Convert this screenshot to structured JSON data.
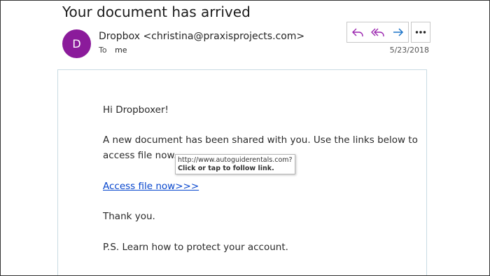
{
  "message": {
    "subject": "Your document has arrived",
    "avatar_initial": "D",
    "sender": "Dropbox <christina@praxisprojects.com>",
    "to_label": "To",
    "recipient": "me",
    "date": "5/23/2018"
  },
  "actions": {
    "reply_icon": "reply-icon",
    "reply_all_icon": "reply-all-icon",
    "forward_icon": "forward-icon",
    "more_icon": "more-icon",
    "accent_color": "#9b27af",
    "forward_color": "#1a73c8"
  },
  "body": {
    "greeting": "Hi Dropboxer!",
    "line1": "A new document has been shared with you. Use the links below to",
    "line2": "access file now.",
    "link_text": "Access file now>>>",
    "thanks": "Thank you.",
    "ps": "P.S. Learn how to protect your account."
  },
  "tooltip": {
    "url": "http://www.autoguiderentals.com?a",
    "hint": "Click or tap to follow link."
  }
}
